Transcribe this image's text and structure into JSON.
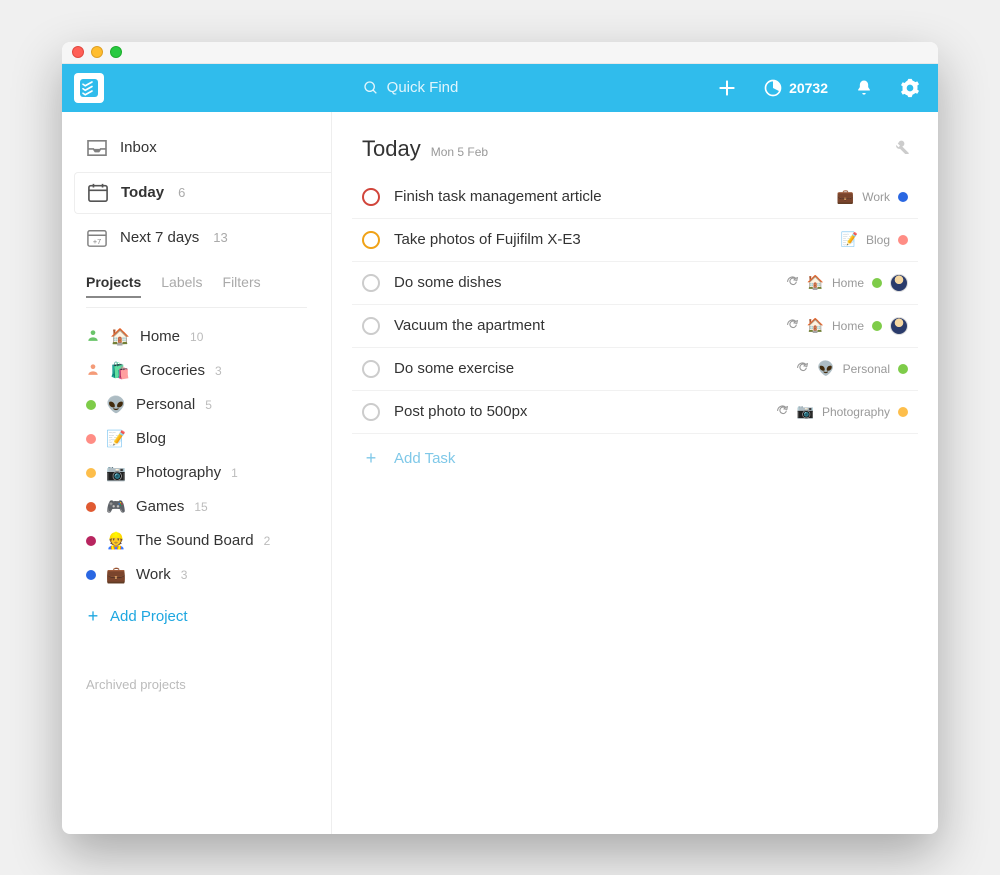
{
  "header": {
    "search_placeholder": "Quick Find",
    "karma": "20732"
  },
  "sidebar": {
    "nav": [
      {
        "label": "Inbox",
        "count": ""
      },
      {
        "label": "Today",
        "count": "6"
      },
      {
        "label": "Next 7 days",
        "count": "13"
      }
    ],
    "tabs": {
      "projects": "Projects",
      "labels": "Labels",
      "filters": "Filters"
    },
    "projects": [
      {
        "shared": true,
        "shared_color": "#6ac46a",
        "dot": "",
        "emoji": "🏠",
        "name": "Home",
        "count": "10"
      },
      {
        "shared": true,
        "shared_color": "#f49b78",
        "dot": "",
        "emoji": "🛍️",
        "name": "Groceries",
        "count": "3"
      },
      {
        "shared": false,
        "shared_color": "",
        "dot": "#7ecc49",
        "emoji": "👽",
        "name": "Personal",
        "count": "5"
      },
      {
        "shared": false,
        "shared_color": "",
        "dot": "#ff8d85",
        "emoji": "📝",
        "name": "Blog",
        "count": ""
      },
      {
        "shared": false,
        "shared_color": "",
        "dot": "#fdbe4b",
        "emoji": "📷",
        "name": "Photography",
        "count": "1"
      },
      {
        "shared": false,
        "shared_color": "",
        "dot": "#e05a32",
        "emoji": "🎮",
        "name": "Games",
        "count": "15"
      },
      {
        "shared": false,
        "shared_color": "",
        "dot": "#b8255f",
        "emoji": "👷",
        "name": "The Sound Board",
        "count": "2"
      },
      {
        "shared": false,
        "shared_color": "",
        "dot": "#2a67e2",
        "emoji": "💼",
        "name": "Work",
        "count": "3"
      }
    ],
    "add_project": "Add Project",
    "archived": "Archived projects"
  },
  "main": {
    "title": "Today",
    "date": "Mon 5 Feb",
    "add_task": "Add Task",
    "tasks": [
      {
        "title": "Finish task management article",
        "priority": "p1",
        "recurring": false,
        "proj_emoji": "💼",
        "proj_name": "Work",
        "proj_dot": "#2a67e2",
        "assignee": false
      },
      {
        "title": "Take photos of Fujifilm X-E3",
        "priority": "p2",
        "recurring": false,
        "proj_emoji": "📝",
        "proj_name": "Blog",
        "proj_dot": "#ff8d85",
        "assignee": false
      },
      {
        "title": "Do some dishes",
        "priority": "",
        "recurring": true,
        "proj_emoji": "🏠",
        "proj_name": "Home",
        "proj_dot": "#7ecc49",
        "assignee": true
      },
      {
        "title": "Vacuum the apartment",
        "priority": "",
        "recurring": true,
        "proj_emoji": "🏠",
        "proj_name": "Home",
        "proj_dot": "#7ecc49",
        "assignee": true
      },
      {
        "title": "Do some exercise",
        "priority": "",
        "recurring": true,
        "proj_emoji": "👽",
        "proj_name": "Personal",
        "proj_dot": "#7ecc49",
        "assignee": false
      },
      {
        "title": "Post photo to 500px",
        "priority": "",
        "recurring": true,
        "proj_emoji": "📷",
        "proj_name": "Photography",
        "proj_dot": "#fdbe4b",
        "assignee": false
      }
    ]
  },
  "colors": {
    "accent": "#30bcec"
  }
}
